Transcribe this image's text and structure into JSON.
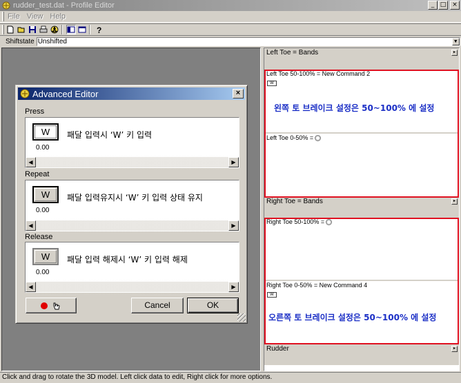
{
  "window": {
    "title": "rudder_test.dat - Profile Editor",
    "minimize_label": "_",
    "maximize_label": "□",
    "close_label": "×"
  },
  "menu": {
    "items": [
      {
        "label": "File"
      },
      {
        "label": "View"
      },
      {
        "label": "Help"
      }
    ]
  },
  "toolbar": {
    "icons": [
      "new-icon",
      "open-icon",
      "save-icon",
      "print-icon",
      "radiation-icon",
      "split-view-icon",
      "single-view-icon",
      "help-icon"
    ]
  },
  "shiftstate": {
    "label": "Shiftstate",
    "value": "Unshifted"
  },
  "right_pane": {
    "left_toe_header": "Left Toe = Bands",
    "left_toe_upper": "Left Toe 50-100% = New Command 2",
    "left_toe_upper_chip": "W",
    "left_toe_note": "왼쪽 토 브레이크 설정은 50~100% 에 설정",
    "left_toe_lower": "Left Toe 0-50% =",
    "right_toe_header": "Right Toe = Bands",
    "right_toe_upper": "Right Toe 50-100% =",
    "right_toe_lower": "Right Toe 0-50% = New Command 4",
    "right_toe_lower_chip": "W",
    "right_toe_note": "오른쪽 토 브레이크 설정은 50~100% 에 설정",
    "rudder_header": "Rudder",
    "expand_glyph": "▸",
    "colors": {
      "highlight_box": "#e01020",
      "note_text": "#1b2fc6"
    }
  },
  "status": {
    "text": "Click and drag to rotate the 3D model. Left click data to edit, Right click for more options."
  },
  "dialog": {
    "title": "Advanced Editor",
    "close_label": "×",
    "press": {
      "label": "Press",
      "key": "W",
      "value": "0.00",
      "description": "패달 입력시 ‘W’ 키 입력"
    },
    "repeat": {
      "label": "Repeat",
      "key": "W",
      "value": "0.00",
      "description": "패달 입력유지시 ‘W’ 키 입력 상태 유지"
    },
    "release": {
      "label": "Release",
      "key": "W",
      "value": "0.00",
      "description": "패달 입력 해제시 ‘W’ 키 입력 해제"
    },
    "cancel_label": "Cancel",
    "ok_label": "OK",
    "scroll_left_glyph": "◀",
    "scroll_right_glyph": "▶"
  }
}
